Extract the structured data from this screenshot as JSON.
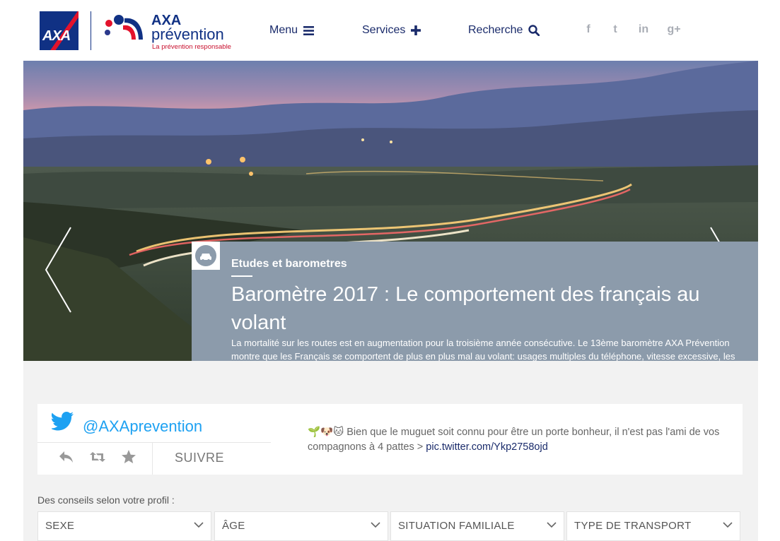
{
  "brand": {
    "axa_logo_text": "AXA",
    "prevention_title": "AXA",
    "prevention_subtitle": "prévention",
    "prevention_tagline": "La prévention responsable"
  },
  "nav": {
    "menu_label": "Menu",
    "services_label": "Services",
    "search_label": "Recherche"
  },
  "social": [
    {
      "icon": "facebook-icon",
      "glyph": "f"
    },
    {
      "icon": "twitter-icon",
      "glyph": "t"
    },
    {
      "icon": "linkedin-icon",
      "glyph": "in"
    },
    {
      "icon": "google-plus-icon",
      "glyph": "g+"
    }
  ],
  "hero": {
    "category": "Etudes et barometres",
    "title": "Baromètre 2017 : Le comportement des français au volant",
    "description": "La mortalité sur les routes est en augmentation pour la troisième année consécutive. Le 13ème baromètre AXA Prévention montre que les Français se comportent de plus en plus mal au volant: usages multiples du téléphone, vitesse excessive, les infractions s’additionnent."
  },
  "twitter": {
    "handle": "@AXAprevention",
    "follow_label": "SUIVRE",
    "tweet_text": "🌱🐶🐱 Bien que le muguet soit connu pour être un porte bonheur, il n'est pas l'ami de vos compagnons à 4 pattes > ",
    "tweet_link": "pic.twitter.com/Ykp2758ojd"
  },
  "profile": {
    "label": "Des conseils selon votre profil :",
    "selects": [
      "SEXE",
      "ÂGE",
      "SITUATION FAMILIALE",
      "TYPE DE TRANSPORT"
    ]
  },
  "colors": {
    "axa_blue": "#103184",
    "axa_red": "#e3122c",
    "caption_bg": "#8c9bab",
    "twitter_blue": "#1da1f2"
  }
}
